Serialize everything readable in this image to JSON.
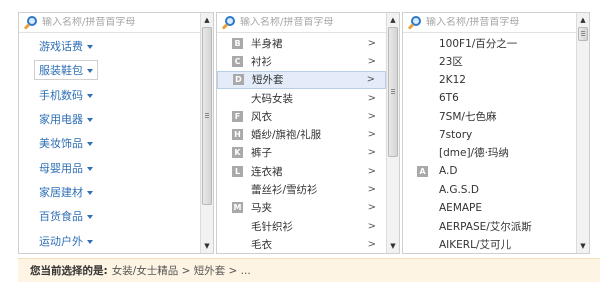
{
  "search": {
    "placeholder": "输入名称/拼音首字母"
  },
  "categories": [
    "游戏话费",
    "服装鞋包",
    "手机数码",
    "家用电器",
    "美妆饰品",
    "母婴用品",
    "家居建材",
    "百货食品",
    "运动户外"
  ],
  "subcategories": [
    {
      "letter": "B",
      "label": "半身裙"
    },
    {
      "letter": "C",
      "label": "衬衫"
    },
    {
      "letter": "D",
      "label": "短外套",
      "selected": true
    },
    {
      "letter": "",
      "label": "大码女装"
    },
    {
      "letter": "F",
      "label": "风衣"
    },
    {
      "letter": "H",
      "label": "婚纱/旗袍/礼服"
    },
    {
      "letter": "K",
      "label": "裤子"
    },
    {
      "letter": "L",
      "label": "连衣裙"
    },
    {
      "letter": "",
      "label": "蕾丝衫/雪纺衫"
    },
    {
      "letter": "M",
      "label": "马夹"
    },
    {
      "letter": "",
      "label": "毛针织衫"
    },
    {
      "letter": "",
      "label": "毛衣"
    }
  ],
  "brands": [
    {
      "letter": "",
      "label": "100F1/百分之一"
    },
    {
      "letter": "",
      "label": "23区"
    },
    {
      "letter": "",
      "label": "2K12"
    },
    {
      "letter": "",
      "label": "6T6"
    },
    {
      "letter": "",
      "label": "7SM/七色麻"
    },
    {
      "letter": "",
      "label": "7story"
    },
    {
      "letter": "",
      "label": "[dme]/德·玛纳"
    },
    {
      "letter": "A",
      "label": "A.D"
    },
    {
      "letter": "",
      "label": "A.G.S.D"
    },
    {
      "letter": "",
      "label": "AEMAPE"
    },
    {
      "letter": "",
      "label": "AERPASE/艾尔派斯"
    },
    {
      "letter": "",
      "label": "AIKERL/艾可儿"
    }
  ],
  "chevron": ">",
  "footer": {
    "label": "您当前选择的是:",
    "path": "女装/女士精品 > 短外套 > ..."
  },
  "colors": {
    "link": "#2f6fb5",
    "footer_bg": "#fdf4e3",
    "selected_bg": "#e3ecf8"
  }
}
